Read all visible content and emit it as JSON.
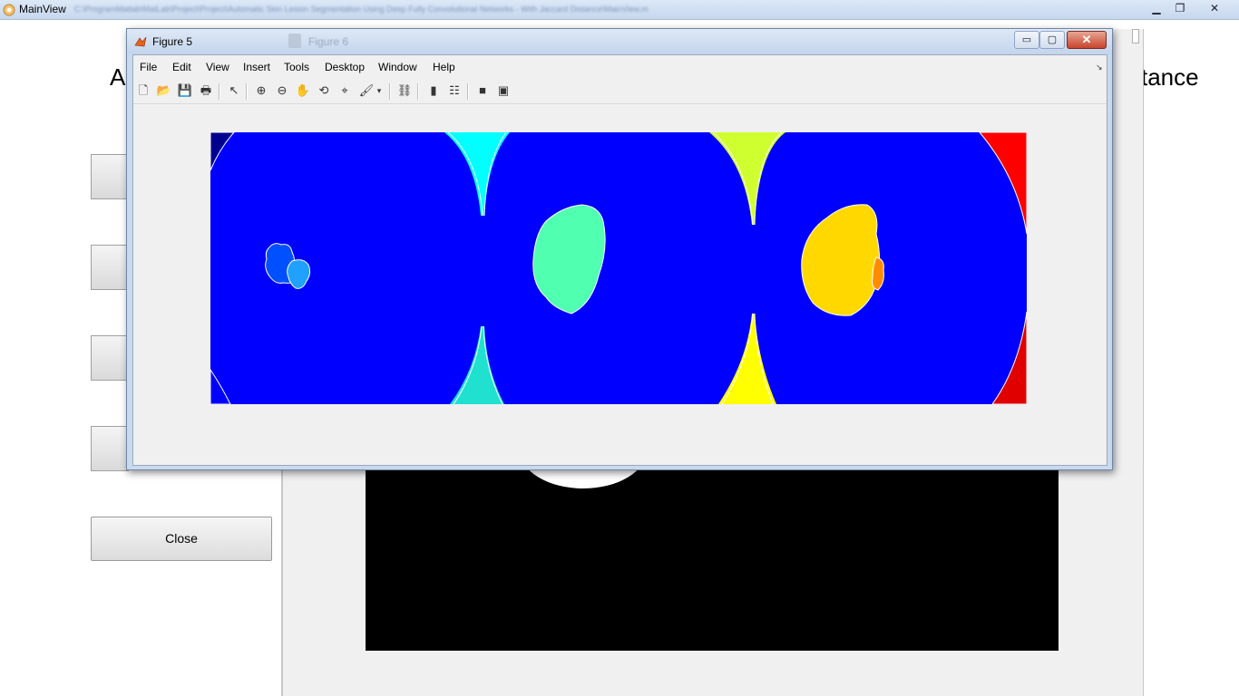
{
  "main_window": {
    "title": "MainView",
    "path": "C:\\ProgramMatlab\\MatLab\\Project\\Project\\Automatic Skin Lesion Segmentation Using Deep Fully Convolutional Networks - With Jaccard Distance\\MainView.m",
    "minimize_label": "▁",
    "maximize_label": "❐",
    "close_label": "✕"
  },
  "background_gui": {
    "heading_left": "A",
    "heading_right": "tance",
    "close_button": "Close"
  },
  "figure5": {
    "title": "Figure 5",
    "ghost_title": "Figure 6",
    "minimize_label": "▭",
    "maximize_label": "▢",
    "close_label": "✕",
    "menu": [
      "File",
      "Edit",
      "View",
      "Insert",
      "Tools",
      "Desktop",
      "Window",
      "Help"
    ],
    "dock_label": "↘",
    "toolbar": {
      "new": "🗋",
      "open": "📂",
      "save": "💾",
      "print": "🖶",
      "pointer": "↖",
      "zoom_in": "⊕",
      "zoom_out": "⊖",
      "pan": "✋",
      "rotate": "⟲",
      "datacursor": "⌖",
      "brush": "🖌",
      "brush_drop": "▾",
      "link": "⛓",
      "colorbar": "▮",
      "legend": "☷",
      "hide_tools": "■",
      "dock_plot": "▣"
    }
  },
  "image_regions": {
    "background_color": "#0000ff",
    "colors": {
      "top_left_corner": "#00008f",
      "lesion_1": "#0050ff",
      "lesion_1_part": "#20a0ff",
      "top_gap_1": "#00ffff",
      "bottom_gap_1": "#20e0d0",
      "lesion_2": "#50ffb0",
      "top_gap_2": "#d0ff30",
      "bottom_gap_2": "#ffff00",
      "lesion_3": "#ffd800",
      "lesion_3_edge": "#ff8c00",
      "top_right_corner": "#ff0000",
      "bottom_right_corner": "#e00000"
    }
  }
}
